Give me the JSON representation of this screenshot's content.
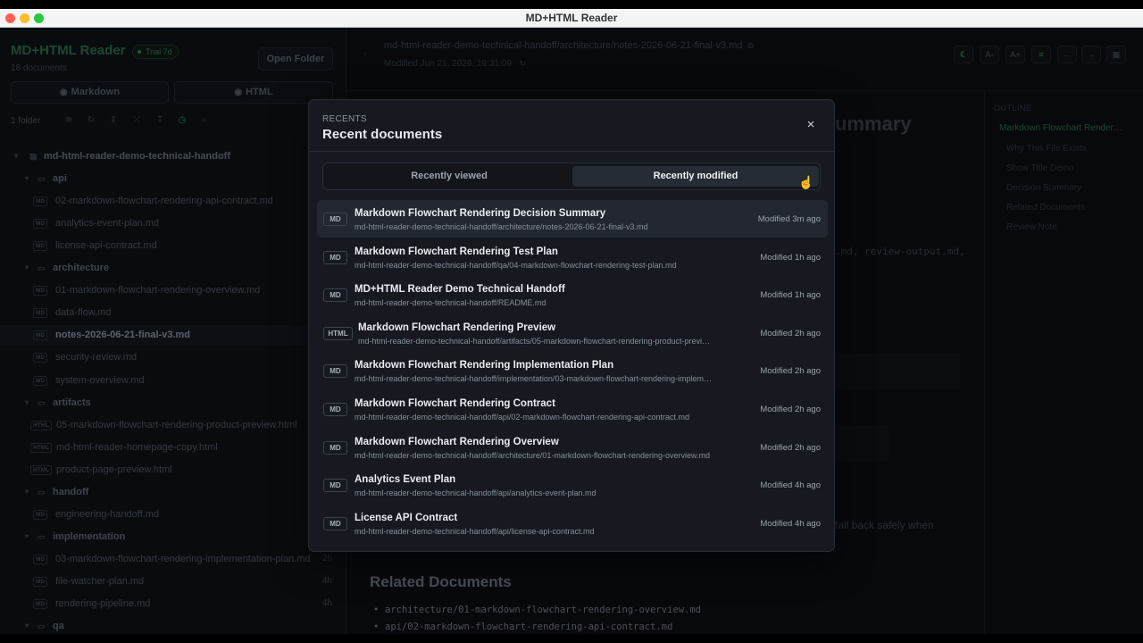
{
  "window": {
    "title": "MD+HTML Reader"
  },
  "sidebar": {
    "brand": "MD+HTML Reader",
    "trial_badge": "Trial 7d",
    "doc_count": "18 documents",
    "open_folder_label": "Open Folder",
    "mode_markdown": "Markdown",
    "mode_html": "HTML",
    "folder_count": "1 folder",
    "tree": [
      {
        "type": "root",
        "label": "md-html-reader-demo-technical-handoff"
      },
      {
        "type": "folder",
        "label": "api"
      },
      {
        "type": "file",
        "badge": "MD",
        "label": "02-markdown-flowchart-rendering-api-contract.md",
        "time": ""
      },
      {
        "type": "file",
        "badge": "MD",
        "label": "analytics-event-plan.md",
        "time": ""
      },
      {
        "type": "file",
        "badge": "MD",
        "label": "license-api-contract.md",
        "time": ""
      },
      {
        "type": "folder",
        "label": "architecture"
      },
      {
        "type": "file",
        "badge": "MD",
        "label": "01-markdown-flowchart-rendering-overview.md",
        "time": ""
      },
      {
        "type": "file",
        "badge": "MD",
        "label": "data-flow.md",
        "time": ""
      },
      {
        "type": "file",
        "badge": "MD",
        "label": "notes-2026-06-21-final-v3.md",
        "time": "",
        "selected": true
      },
      {
        "type": "file",
        "badge": "MD",
        "label": "security-review.md",
        "time": ""
      },
      {
        "type": "file",
        "badge": "MD",
        "label": "system-overview.md",
        "time": ""
      },
      {
        "type": "folder",
        "label": "artifacts"
      },
      {
        "type": "file",
        "badge": "HTML",
        "label": "05-markdown-flowchart-rendering-product-preview.html",
        "time": ""
      },
      {
        "type": "file",
        "badge": "HTML",
        "label": "md-html-reader-homepage-copy.html",
        "time": ""
      },
      {
        "type": "file",
        "badge": "HTML",
        "label": "product-page-preview.html",
        "time": ""
      },
      {
        "type": "folder",
        "label": "handoff"
      },
      {
        "type": "file",
        "badge": "MD",
        "label": "engineering-handoff.md",
        "time": ""
      },
      {
        "type": "folder",
        "label": "implementation"
      },
      {
        "type": "file",
        "badge": "MD",
        "label": "03-markdown-flowchart-rendering-implementation-plan.md",
        "time": "2h"
      },
      {
        "type": "file",
        "badge": "MD",
        "label": "file-watcher-plan.md",
        "time": "4h"
      },
      {
        "type": "file",
        "badge": "MD",
        "label": "rendering-pipeline.md",
        "time": "4h"
      },
      {
        "type": "folder",
        "label": "qa"
      }
    ]
  },
  "main": {
    "path": "md-html-reader-demo-technical-handoff/architecture/notes-2026-06-21-final-v3.md",
    "modified": "Modified Jun 21, 2026, 19:31:09",
    "header_buttons": [
      "A-",
      "A+"
    ],
    "bg_heading_tail": "ummary",
    "bg_mono_tail": ".md, review-output.md,",
    "bg_text_tail": "fall back safely when",
    "related_heading": "Related Documents",
    "related_items": [
      "architecture/01-markdown-flowchart-rendering-overview.md",
      "api/02-markdown-flowchart-rendering-api-contract.md"
    ]
  },
  "outline": {
    "label": "OUTLINE",
    "items": [
      "Markdown Flowchart Render…",
      "Why This File Exists",
      "Show Title Demo",
      "Decision Summary",
      "Related Documents",
      "Review Note"
    ]
  },
  "modal": {
    "eyebrow": "RECENTS",
    "title": "Recent documents",
    "close_glyph": "×",
    "tab_viewed": "Recently viewed",
    "tab_modified": "Recently modified",
    "items": [
      {
        "badge": "MD",
        "title": "Markdown Flowchart Rendering Decision Summary",
        "path": "md-html-reader-demo-technical-handoff/architecture/notes-2026-06-21-final-v3.md",
        "time": "Modified 3m ago"
      },
      {
        "badge": "MD",
        "title": "Markdown Flowchart Rendering Test Plan",
        "path": "md-html-reader-demo-technical-handoff/qa/04-markdown-flowchart-rendering-test-plan.md",
        "time": "Modified 1h ago"
      },
      {
        "badge": "MD",
        "title": "MD+HTML Reader Demo Technical Handoff",
        "path": "md-html-reader-demo-technical-handoff/README.md",
        "time": "Modified 1h ago"
      },
      {
        "badge": "HTML",
        "title": "Markdown Flowchart Rendering Preview",
        "path": "md-html-reader-demo-technical-handoff/artifacts/05-markdown-flowchart-rendering-product-previ…",
        "time": "Modified 2h ago"
      },
      {
        "badge": "MD",
        "title": "Markdown Flowchart Rendering Implementation Plan",
        "path": "md-html-reader-demo-technical-handoff/implementation/03-markdown-flowchart-rendering-implem…",
        "time": "Modified 2h ago"
      },
      {
        "badge": "MD",
        "title": "Markdown Flowchart Rendering Contract",
        "path": "md-html-reader-demo-technical-handoff/api/02-markdown-flowchart-rendering-api-contract.md",
        "time": "Modified 2h ago"
      },
      {
        "badge": "MD",
        "title": "Markdown Flowchart Rendering Overview",
        "path": "md-html-reader-demo-technical-handoff/architecture/01-markdown-flowchart-rendering-overview.md",
        "time": "Modified 2h ago"
      },
      {
        "badge": "MD",
        "title": "Analytics Event Plan",
        "path": "md-html-reader-demo-technical-handoff/api/analytics-event-plan.md",
        "time": "Modified 4h ago"
      },
      {
        "badge": "MD",
        "title": "License API Contract",
        "path": "md-html-reader-demo-technical-handoff/api/license-api-contract.md",
        "time": "Modified 4h ago"
      }
    ]
  },
  "colors": {
    "accent": "#2f8a57",
    "modal_bg": "#161a20",
    "app_bg": "#0b0f14"
  }
}
